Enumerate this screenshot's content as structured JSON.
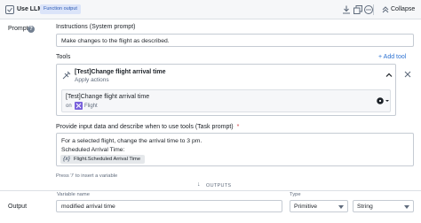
{
  "header": {
    "title": "Use LLM",
    "badge": "Function output",
    "collapse_label": "Collapse"
  },
  "prompt": {
    "section_label": "Prompt",
    "instructions_label": "Instructions (System prompt)",
    "instructions_value": "Make changes to the flight as described."
  },
  "tools": {
    "label": "Tools",
    "add_tool_label": "+ Add tool",
    "tool": {
      "title": "[Test]Change flight arrival time",
      "subtitle": "Apply actions",
      "inner_title": "[Test]Change flight arrival time",
      "on_label": "on",
      "object_type": "Flight"
    }
  },
  "task": {
    "label": "Provide input data and describe when to use tools (Task prompt)",
    "required_mark": "*",
    "line1": "For a selected flight, change the arrival time to 3 pm.",
    "line2": "Scheduled Arrival Time:",
    "variable_fx": "{x}",
    "variable_name": "Flight.Scheduled Arrival Time",
    "hint": "Press '/' to insert a variable"
  },
  "outputs": {
    "divider_label": "OUTPUTS",
    "section_label": "Output",
    "variable_name_label": "Variable name",
    "variable_name_value": "modified arrival time",
    "type_label": "Type",
    "type_value": "Primitive",
    "subtype_value": "String"
  },
  "colors": {
    "accent": "#2d72d2",
    "badge_bg": "#dbe4f9",
    "object_icon": "#7961db"
  }
}
